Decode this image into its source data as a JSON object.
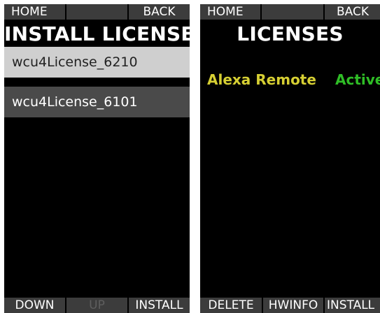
{
  "left_screen": {
    "top_bar": {
      "home": "HOME",
      "back": "BACK"
    },
    "title": "INSTALL LICENSE",
    "items": [
      {
        "label": "wcu4License_6210"
      },
      {
        "label": "wcu4License_6101"
      }
    ],
    "bottom_bar": {
      "down": "DOWN",
      "up": "UP",
      "install": "INSTALL"
    }
  },
  "right_screen": {
    "top_bar": {
      "home": "HOME",
      "back": "BACK"
    },
    "title": "LICENSES",
    "licenses": [
      {
        "name": "Alexa Remote",
        "status": "Active"
      }
    ],
    "bottom_bar": {
      "delete": "DELETE",
      "hwinfo": "HWINFO",
      "install": "INSTALL"
    }
  },
  "colors": {
    "license_name": "#d6cf33",
    "license_status": "#2fbd26",
    "button_bg": "#3c3c3c",
    "selected_bg": "#cfcfcf"
  }
}
